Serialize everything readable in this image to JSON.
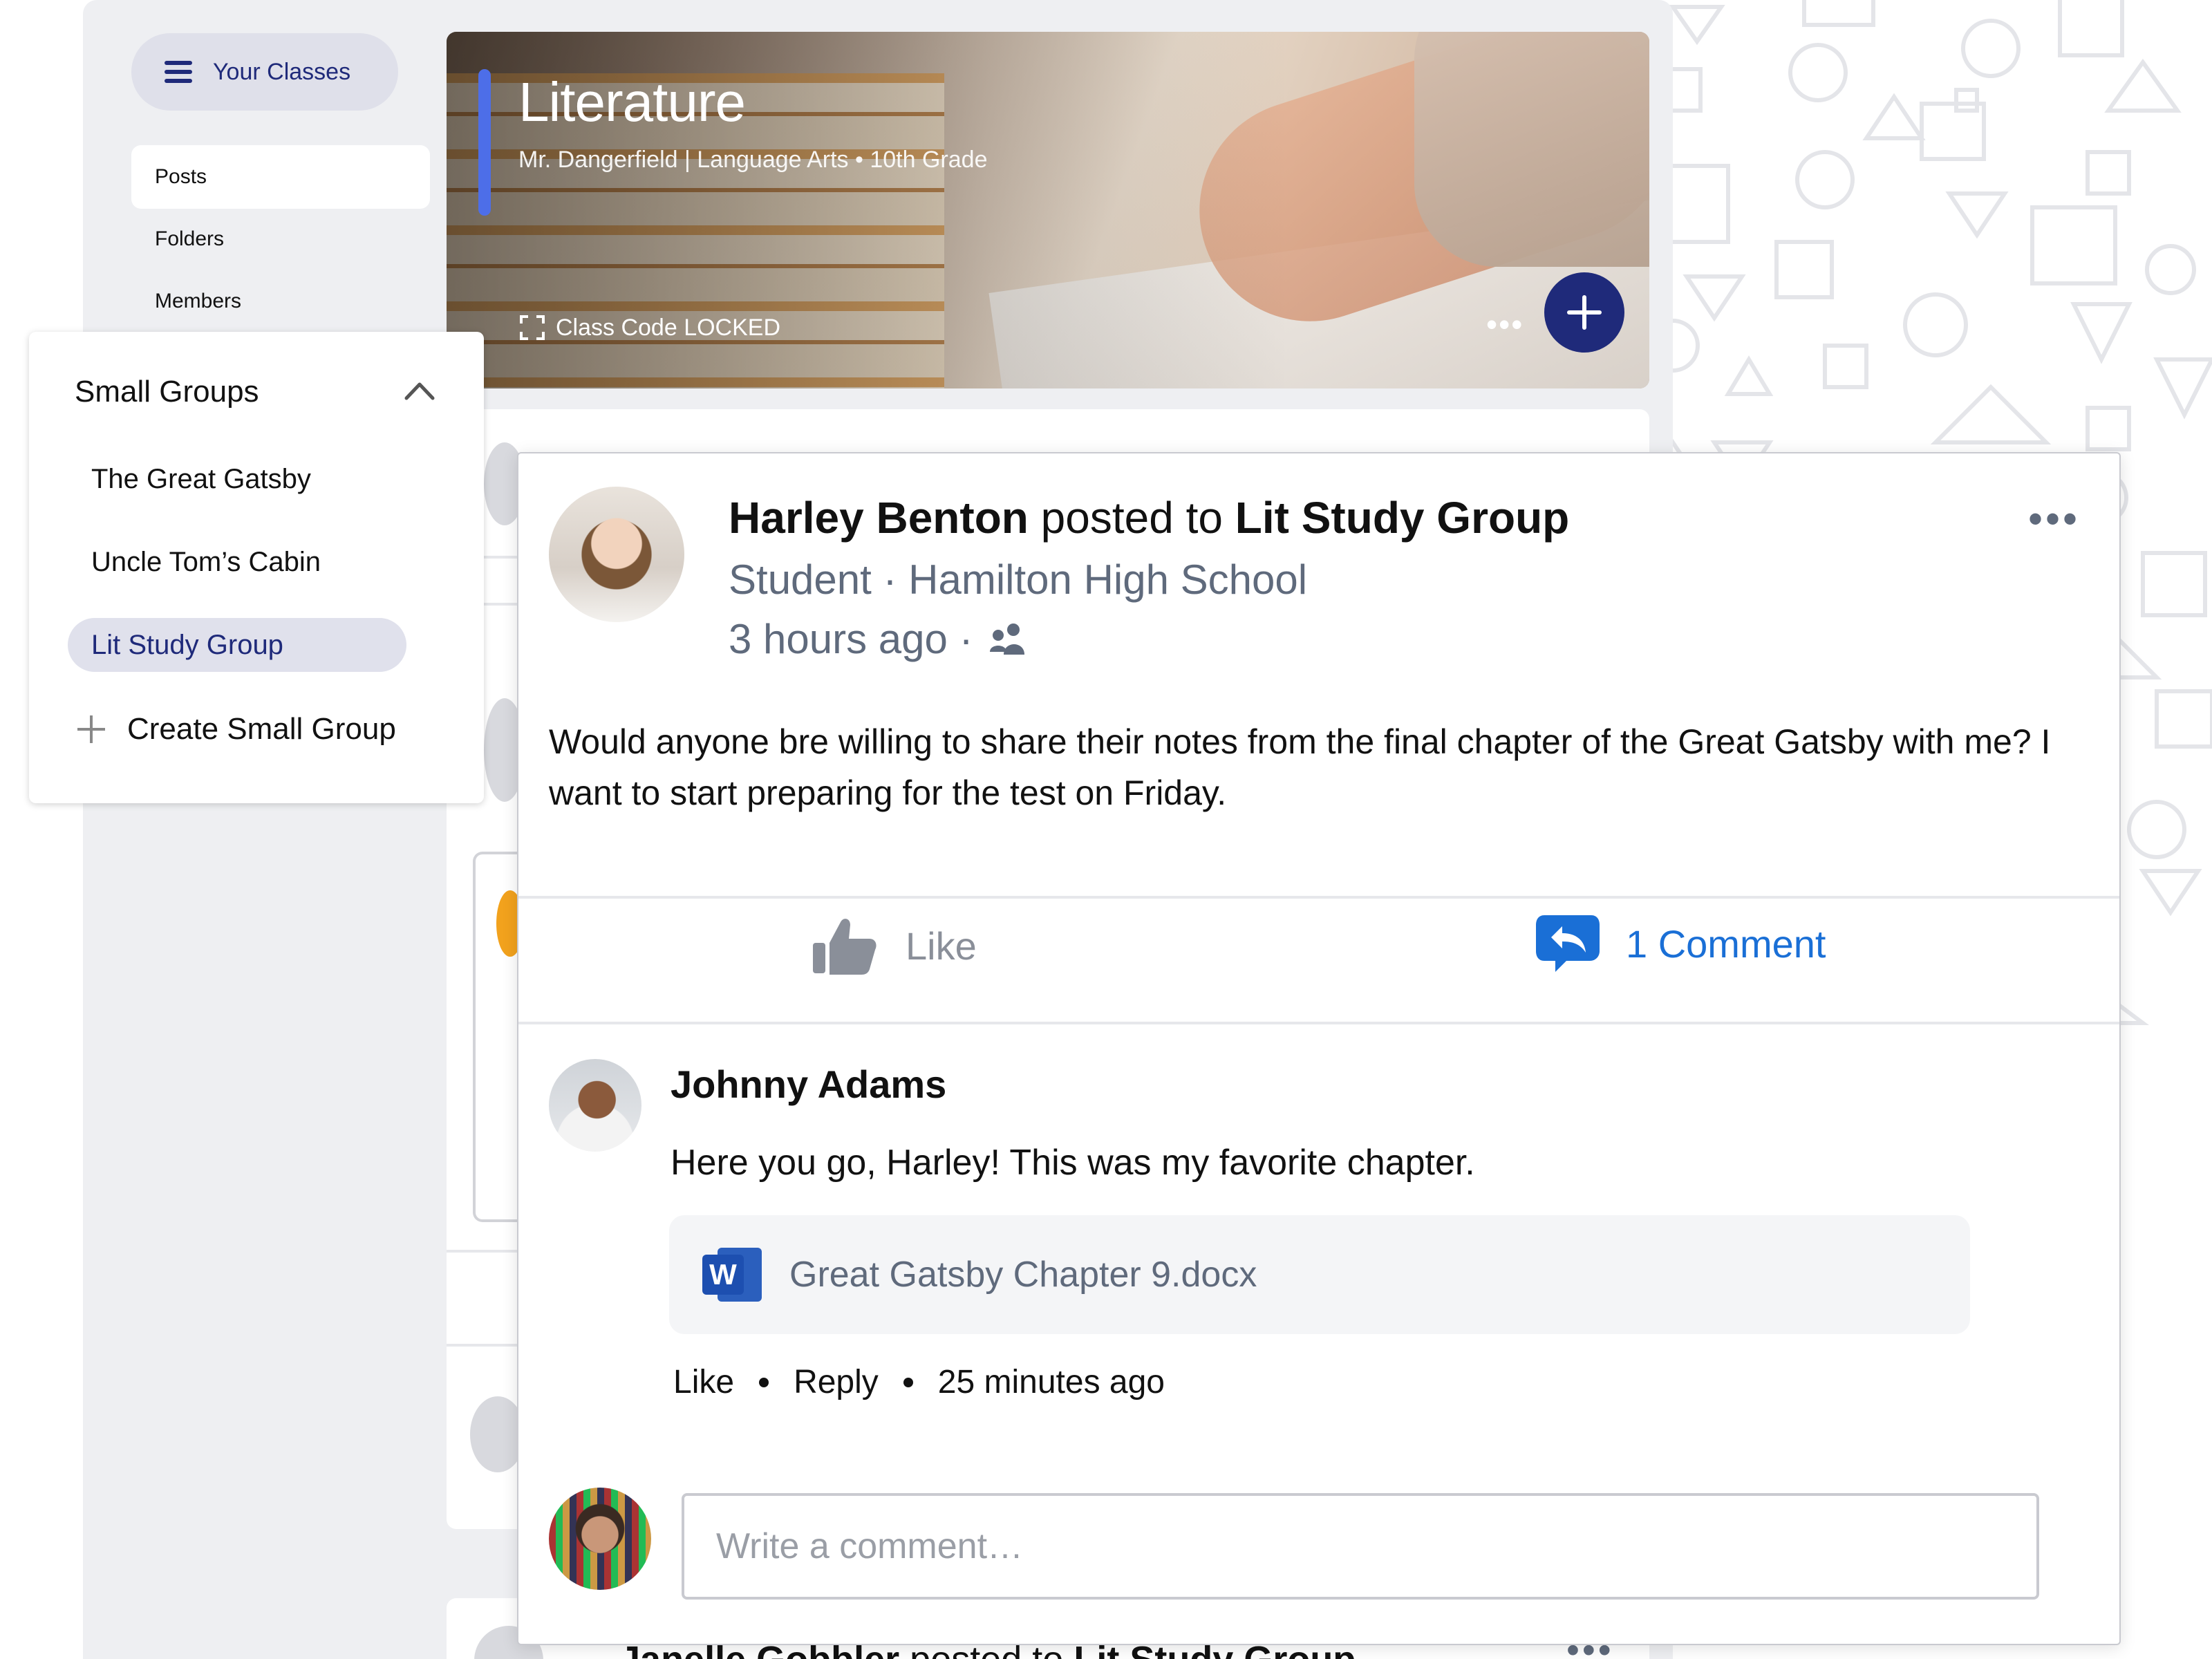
{
  "sidebar": {
    "your_classes_label": "Your Classes",
    "nav": [
      {
        "label": "Posts",
        "active": true
      },
      {
        "label": "Folders",
        "active": false
      },
      {
        "label": "Members",
        "active": false
      }
    ],
    "small_groups": {
      "title": "Small Groups",
      "items": [
        {
          "label": "The Great Gatsby",
          "active": false
        },
        {
          "label": "Uncle Tom’s Cabin",
          "active": false
        },
        {
          "label": "Lit Study Group",
          "active": true
        }
      ],
      "create_label": "Create Small Group"
    }
  },
  "banner": {
    "title": "Literature",
    "subtitle": "Mr. Dangerfield | Language Arts • 10th Grade",
    "class_code": "Class Code LOCKED",
    "more": "•••",
    "accent_color": "#4d6ee8",
    "add_button_color": "#1f2a7a"
  },
  "post": {
    "author": "Harley Benton",
    "posted_to_text": "posted to",
    "group": "Lit Study Group",
    "role_school": "Student · Hamilton High School",
    "time": "3 hours ago ·",
    "more": "•••",
    "body": "Would anyone bre willing to share their notes from the final chapter of the Great Gatsby with me? I want to start preparing for the test on Friday.",
    "like_label": "Like",
    "comment_label": "1 Comment",
    "comment_color": "#1a6fd6"
  },
  "comment": {
    "author": "Johnny Adams",
    "text": "Here you go, Harley! This was my favorite chapter.",
    "attachment": {
      "name": "Great Gatsby Chapter 9.docx",
      "icon": "W"
    },
    "like_label": "Like",
    "reply_label": "Reply",
    "time": "25 minutes ago"
  },
  "composer": {
    "placeholder": "Write a comment…"
  },
  "next_post": {
    "author": "Janelle Gobbler",
    "posted_to_text": "posted to",
    "group": "Lit Study Group",
    "more": "•••"
  }
}
